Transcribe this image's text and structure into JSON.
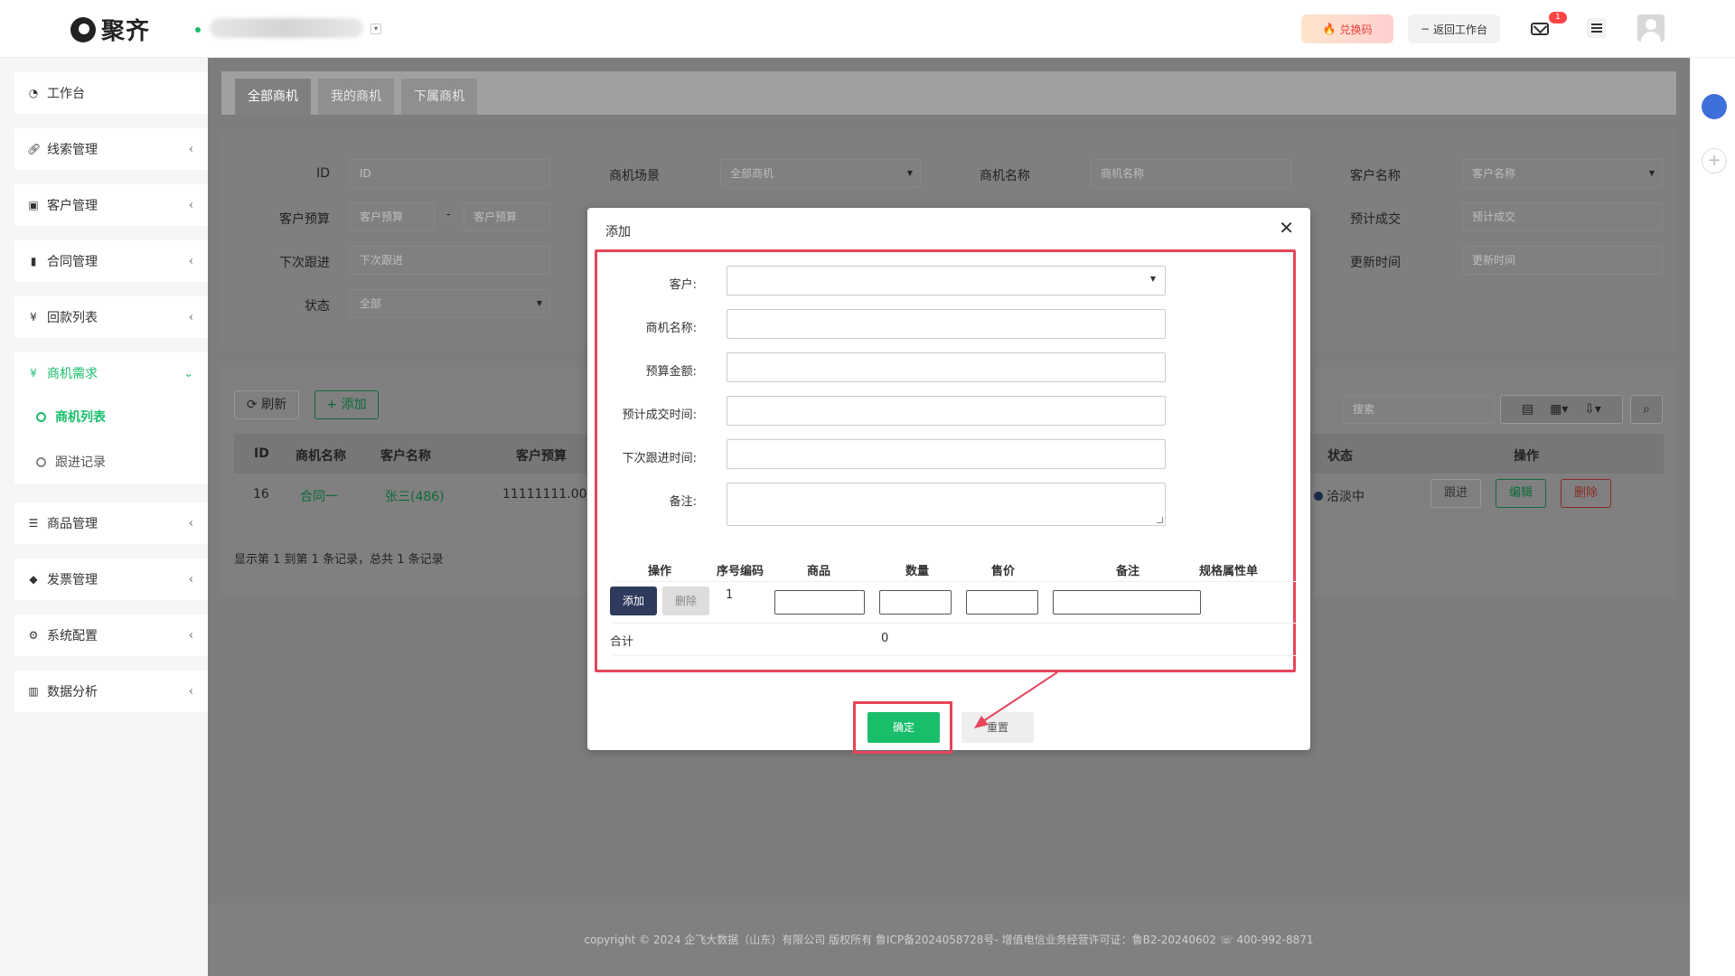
{
  "header": {
    "brand": "聚齐",
    "exchange_code": "兑换码",
    "back_workspace": "返回工作台",
    "mail_badge": "1"
  },
  "sidebar": {
    "items": [
      {
        "icon": "dashboard-icon",
        "label": "工作台"
      },
      {
        "icon": "link-icon",
        "label": "线索管理"
      },
      {
        "icon": "id-card-icon",
        "label": "客户管理"
      },
      {
        "icon": "bookmark-icon",
        "label": "合同管理"
      },
      {
        "icon": "yen-icon",
        "label": "回款列表"
      },
      {
        "icon": "yen-icon",
        "label": "商机需求"
      },
      {
        "icon": "list-icon",
        "label": "商品管理"
      },
      {
        "icon": "ticket-icon",
        "label": "发票管理"
      },
      {
        "icon": "gears-icon",
        "label": "系统配置"
      },
      {
        "icon": "bar-chart-icon",
        "label": "数据分析"
      }
    ],
    "sub_items": [
      "商机列表",
      "跟进记录"
    ]
  },
  "tabs": [
    "全部商机",
    "我的商机",
    "下属商机"
  ],
  "filters": {
    "id_label": "ID",
    "id_placeholder": "ID",
    "scene_label": "商机场景",
    "scene_value": "全部商机",
    "name_label": "商机名称",
    "name_placeholder": "商机名称",
    "customer_label": "客户名称",
    "customer_placeholder": "客户名称",
    "budget_label": "客户预算",
    "budget_placeholder": "客户预算",
    "range_sep": "-",
    "deal_label": "预计成交",
    "deal_placeholder": "预计成交",
    "next_label": "下次跟进",
    "next_placeholder": "下次跟进",
    "update_label": "更新时间",
    "update_placeholder": "更新时间",
    "status_label": "状态",
    "status_value": "全部"
  },
  "toolbar": {
    "refresh": "刷新",
    "add": "添加",
    "search_placeholder": "搜索"
  },
  "table": {
    "headers": [
      "ID",
      "商机名称",
      "客户名称",
      "客户预算",
      "状态",
      "操作"
    ],
    "row": {
      "id": "16",
      "name": "合同一",
      "customer": "张三(486)",
      "budget": "11111111.00",
      "status": "洽淡中",
      "follow": "跟进",
      "edit": "编辑",
      "delete": "删除"
    },
    "pager": "显示第 1 到第 1 条记录，总共 1 条记录"
  },
  "modal": {
    "title": "添加",
    "fields": {
      "customer": "客户:",
      "name": "商机名称:",
      "budget": "预算金额:",
      "deal_time": "预计成交时间:",
      "next_time": "下次跟进时间:",
      "remark": "备注:"
    },
    "goods_headers": [
      "操作",
      "序号编码",
      "商品",
      "数量",
      "售价",
      "备注",
      "规格属性单"
    ],
    "goods_add": "添加",
    "goods_delete": "删除",
    "goods_row_no": "1",
    "total_label": "合计",
    "total_value": "0",
    "confirm": "确定",
    "reset": "重置"
  },
  "footer": {
    "text": "copyright © 2024 企飞大数据（山东）有限公司 版权所有  鲁ICP备2024058728号-  增值电信业务经营许可证：鲁B2-20240602 ☏ 400-992-8871"
  },
  "colors": {
    "accent": "#19be6b",
    "highlight": "#e5455b",
    "dark_button": "#2f3b5c"
  }
}
